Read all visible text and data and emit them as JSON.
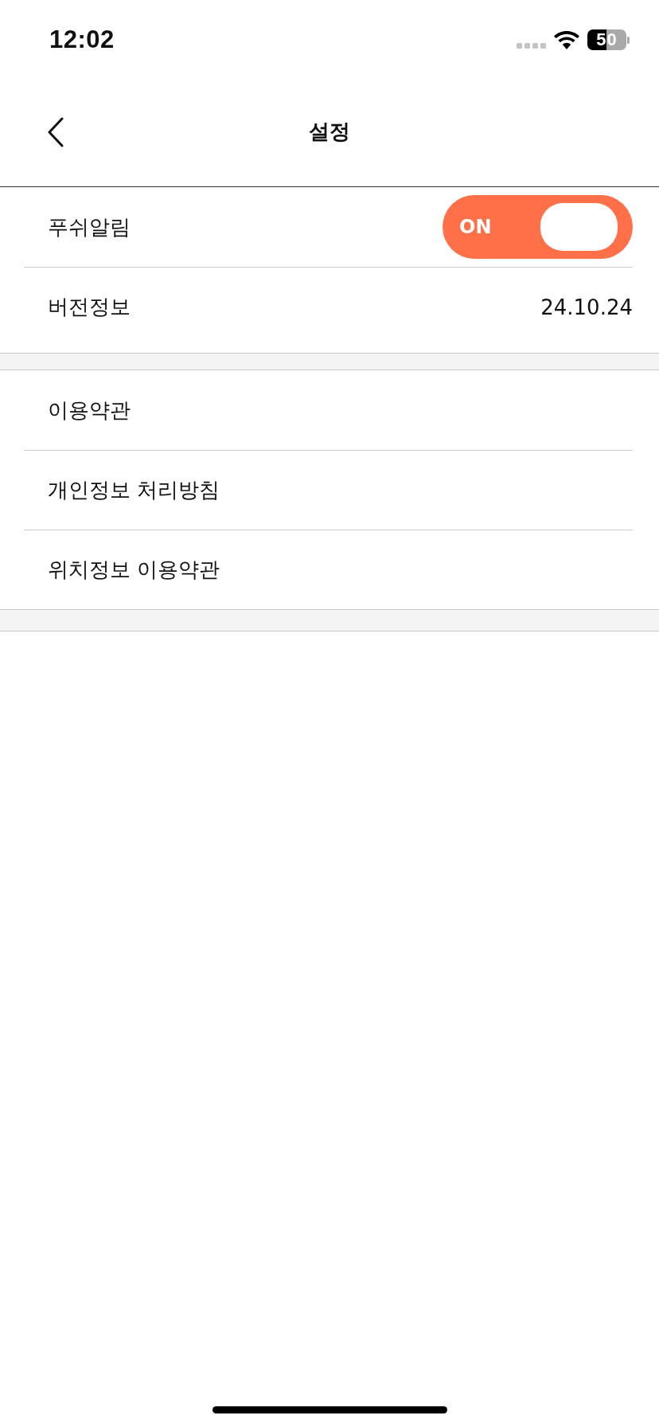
{
  "status_bar": {
    "time": "12:02",
    "battery_text": "50"
  },
  "header": {
    "title": "설정"
  },
  "sections": [
    {
      "rows": [
        {
          "kind": "toggle",
          "label": "푸쉬알림",
          "on": true,
          "switch_text": "ON"
        },
        {
          "kind": "value",
          "label": "버전정보",
          "value": "24.10.24"
        }
      ]
    },
    {
      "rows": [
        {
          "kind": "link",
          "label": "이용약관"
        },
        {
          "kind": "link",
          "label": "개인정보 처리방침"
        },
        {
          "kind": "link",
          "label": "위치정보 이용약관"
        }
      ]
    }
  ]
}
